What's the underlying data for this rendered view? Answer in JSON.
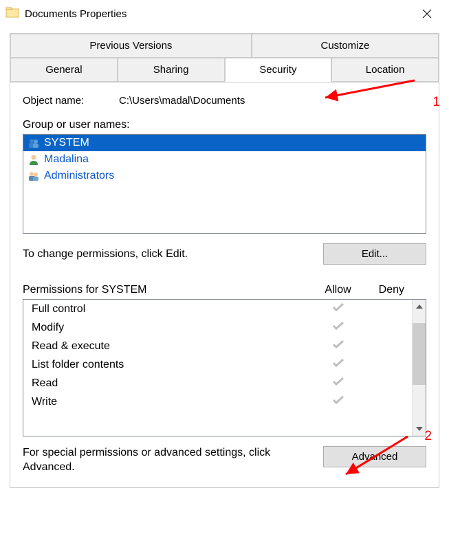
{
  "window": {
    "title": "Documents Properties"
  },
  "tabs": {
    "row1": [
      {
        "label": "Previous Versions"
      },
      {
        "label": "Customize"
      }
    ],
    "row2": [
      {
        "label": "General"
      },
      {
        "label": "Sharing"
      },
      {
        "label": "Security",
        "active": true
      },
      {
        "label": "Location"
      }
    ]
  },
  "security": {
    "objectNameLabel": "Object name:",
    "objectName": "C:\\Users\\madal\\Documents",
    "groupLabel": "Group or user names:",
    "users": [
      {
        "name": "SYSTEM",
        "icon": "users",
        "selected": true
      },
      {
        "name": "Madalina",
        "icon": "user",
        "selected": false
      },
      {
        "name": "Administrators",
        "icon": "admins",
        "selected": false
      }
    ],
    "editHint": "To change permissions, click Edit.",
    "editButton": "Edit...",
    "permissionsForPrefix": "Permissions for",
    "permissionsForName": "SYSTEM",
    "allowLabel": "Allow",
    "denyLabel": "Deny",
    "permissions": [
      {
        "name": "Full control",
        "allow": true,
        "deny": false
      },
      {
        "name": "Modify",
        "allow": true,
        "deny": false
      },
      {
        "name": "Read & execute",
        "allow": true,
        "deny": false
      },
      {
        "name": "List folder contents",
        "allow": true,
        "deny": false
      },
      {
        "name": "Read",
        "allow": true,
        "deny": false
      },
      {
        "name": "Write",
        "allow": true,
        "deny": false
      }
    ],
    "advancedHint": "For special permissions or advanced settings, click Advanced.",
    "advancedButton": "Advanced"
  },
  "annotations": {
    "one": "1",
    "two": "2"
  }
}
